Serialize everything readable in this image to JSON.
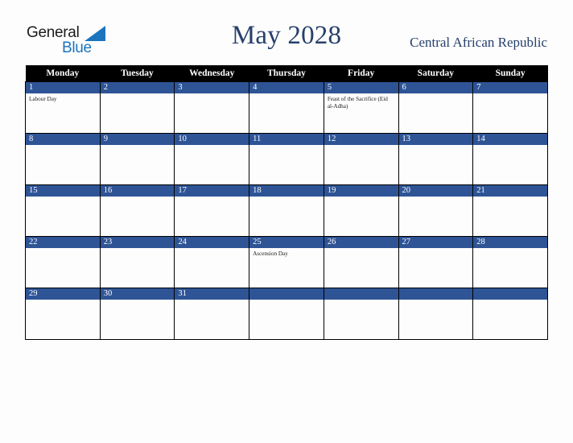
{
  "brand": {
    "name_top": "General",
    "name_bottom": "Blue",
    "top_color": "#1b1b1b",
    "bottom_color": "#1b74bd",
    "triangle_color": "#1b74bd"
  },
  "header": {
    "title": "May 2028",
    "country": "Central African Republic",
    "title_color": "#27406c"
  },
  "calendar": {
    "month": "May",
    "year": "2028",
    "header_bg": "#000000",
    "header_text_color": "#ffffff",
    "daynum_bg": "#2e5496",
    "daynum_text_color": "#ffffff",
    "grid_line_color": "#000000",
    "weekdays": [
      "Monday",
      "Tuesday",
      "Wednesday",
      "Thursday",
      "Friday",
      "Saturday",
      "Sunday"
    ],
    "weeks": [
      [
        {
          "day": "1",
          "events": [
            "Labour Day"
          ]
        },
        {
          "day": "2",
          "events": []
        },
        {
          "day": "3",
          "events": []
        },
        {
          "day": "4",
          "events": []
        },
        {
          "day": "5",
          "events": [
            "Feast of the Sacrifice (Eid al-Adha)"
          ]
        },
        {
          "day": "6",
          "events": []
        },
        {
          "day": "7",
          "events": []
        }
      ],
      [
        {
          "day": "8",
          "events": []
        },
        {
          "day": "9",
          "events": []
        },
        {
          "day": "10",
          "events": []
        },
        {
          "day": "11",
          "events": []
        },
        {
          "day": "12",
          "events": []
        },
        {
          "day": "13",
          "events": []
        },
        {
          "day": "14",
          "events": []
        }
      ],
      [
        {
          "day": "15",
          "events": []
        },
        {
          "day": "16",
          "events": []
        },
        {
          "day": "17",
          "events": []
        },
        {
          "day": "18",
          "events": []
        },
        {
          "day": "19",
          "events": []
        },
        {
          "day": "20",
          "events": []
        },
        {
          "day": "21",
          "events": []
        }
      ],
      [
        {
          "day": "22",
          "events": []
        },
        {
          "day": "23",
          "events": []
        },
        {
          "day": "24",
          "events": []
        },
        {
          "day": "25",
          "events": [
            "Ascension Day"
          ]
        },
        {
          "day": "26",
          "events": []
        },
        {
          "day": "27",
          "events": []
        },
        {
          "day": "28",
          "events": []
        }
      ],
      [
        {
          "day": "29",
          "events": []
        },
        {
          "day": "30",
          "events": []
        },
        {
          "day": "31",
          "events": []
        },
        {
          "day": "",
          "events": []
        },
        {
          "day": "",
          "events": []
        },
        {
          "day": "",
          "events": []
        },
        {
          "day": "",
          "events": []
        }
      ]
    ]
  }
}
